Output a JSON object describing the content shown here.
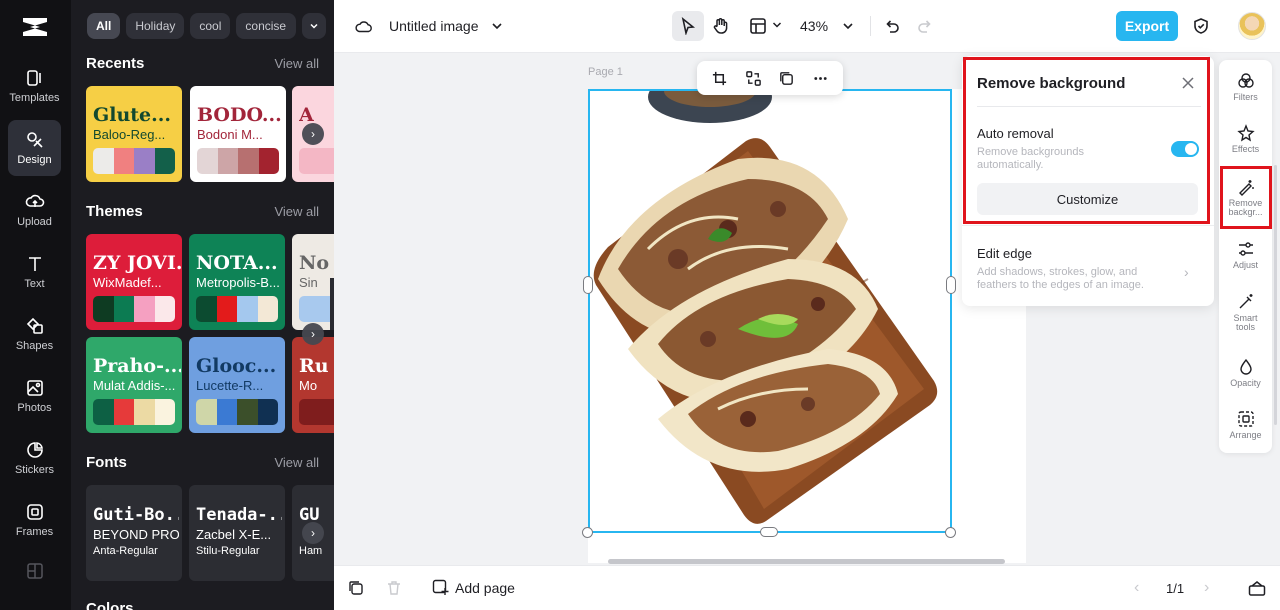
{
  "rail": {
    "items": [
      {
        "label": "Templates",
        "icon": "templates-icon"
      },
      {
        "label": "Design",
        "icon": "design-icon"
      },
      {
        "label": "Upload",
        "icon": "upload-icon"
      },
      {
        "label": "Text",
        "icon": "text-icon"
      },
      {
        "label": "Shapes",
        "icon": "shapes-icon"
      },
      {
        "label": "Photos",
        "icon": "photos-icon"
      },
      {
        "label": "Stickers",
        "icon": "stickers-icon"
      },
      {
        "label": "Frames",
        "icon": "frames-icon"
      }
    ]
  },
  "panel": {
    "chips": [
      "All",
      "Holiday",
      "cool",
      "concise"
    ],
    "recents": {
      "title": "Recents",
      "view_all": "View all",
      "cards": [
        {
          "title": "Glute...",
          "sub": "Baloo-Reg...",
          "bg": "#f6cf45",
          "fg": "#12492f",
          "swatches": [
            "#ecebe9",
            "#f08080",
            "#9a7fc6",
            "#13604a"
          ]
        },
        {
          "title": "BODO...",
          "sub": "Bodoni M...",
          "bg": "#ffffff",
          "fg": "#a2253a",
          "swatches": [
            "#e3d5d6",
            "#cda5a7",
            "#b77070",
            "#a3232f"
          ]
        },
        {
          "title": "A",
          "sub": "",
          "bg": "#fbd6de",
          "fg": "#a2253a",
          "swatches": [
            "#f4b7c5"
          ]
        }
      ]
    },
    "themes": {
      "title": "Themes",
      "view_all": "View all",
      "cards": [
        {
          "title": "ZY JOVI...",
          "sub": "WixMadef...",
          "bg": "#dd1d3a",
          "fg": "#ffffff",
          "swatches": [
            "#0e3b22",
            "#0c7b52",
            "#f5a0c1",
            "#fbe8ea"
          ]
        },
        {
          "title": "NOTA...",
          "sub": "Metropolis-B...",
          "bg": "#0e8356",
          "fg": "#ffffff",
          "swatches": [
            "#0c4b30",
            "#e31b1b",
            "#a4c8ee",
            "#f3e8d6"
          ]
        },
        {
          "title": "No",
          "sub": "Sin",
          "bg": "#eeeae4",
          "fg": "#666666",
          "swatches": [
            "#a8c9ee"
          ]
        },
        {
          "title": "Praho-...",
          "sub": "Mulat Addis-...",
          "bg": "#2fa86a",
          "fg": "#ffffff",
          "swatches": [
            "#0d6044",
            "#e63a3a",
            "#ecdaa4",
            "#faf3df"
          ]
        },
        {
          "title": "Glooc...",
          "sub": "Lucette-R...",
          "bg": "#6f9fe0",
          "fg": "#123a63",
          "swatches": [
            "#cfd6a8",
            "#3b7ad3",
            "#3b4f2a",
            "#103052"
          ]
        },
        {
          "title": "Ru",
          "sub": "Mo",
          "bg": "#b3372f",
          "fg": "#ffffff",
          "swatches": [
            "#7f1d1d"
          ]
        }
      ]
    },
    "fonts": {
      "title": "Fonts",
      "view_all": "View all",
      "cards": [
        {
          "f1": "Guti-Bo...",
          "f2": "BEYOND PRO...",
          "f3": "Anta-Regular"
        },
        {
          "f1": "Tenada-...",
          "f2": "Zacbel X-E...",
          "f3": "Stilu-Regular"
        },
        {
          "f1": "GU",
          "f2": "",
          "f3": "Ham"
        }
      ]
    },
    "colors_title": "Colors"
  },
  "topbar": {
    "doc_title": "Untitled image",
    "zoom": "43%",
    "export_label": "Export"
  },
  "canvas": {
    "page_label": "Page 1"
  },
  "remove_bg": {
    "title": "Remove background",
    "auto_label": "Auto removal",
    "auto_desc": "Remove backgrounds automatically.",
    "auto_on": true,
    "customize_label": "Customize",
    "edge_label": "Edit edge",
    "edge_desc": "Add shadows, strokes, glow, and feathers to the edges of an image."
  },
  "right_rail": {
    "items": [
      {
        "label": "Filters",
        "icon": "filters-icon"
      },
      {
        "label": "Effects",
        "icon": "effects-icon"
      },
      {
        "label": "Remove backgr...",
        "icon": "remove-background-icon"
      },
      {
        "label": "Adjust",
        "icon": "adjust-icon"
      },
      {
        "label": "Smart tools",
        "icon": "smart-tools-icon"
      },
      {
        "label": "Opacity",
        "icon": "opacity-icon"
      },
      {
        "label": "Arrange",
        "icon": "arrange-icon"
      }
    ]
  },
  "bottombar": {
    "add_page": "Add page",
    "page_count": "1/1"
  }
}
